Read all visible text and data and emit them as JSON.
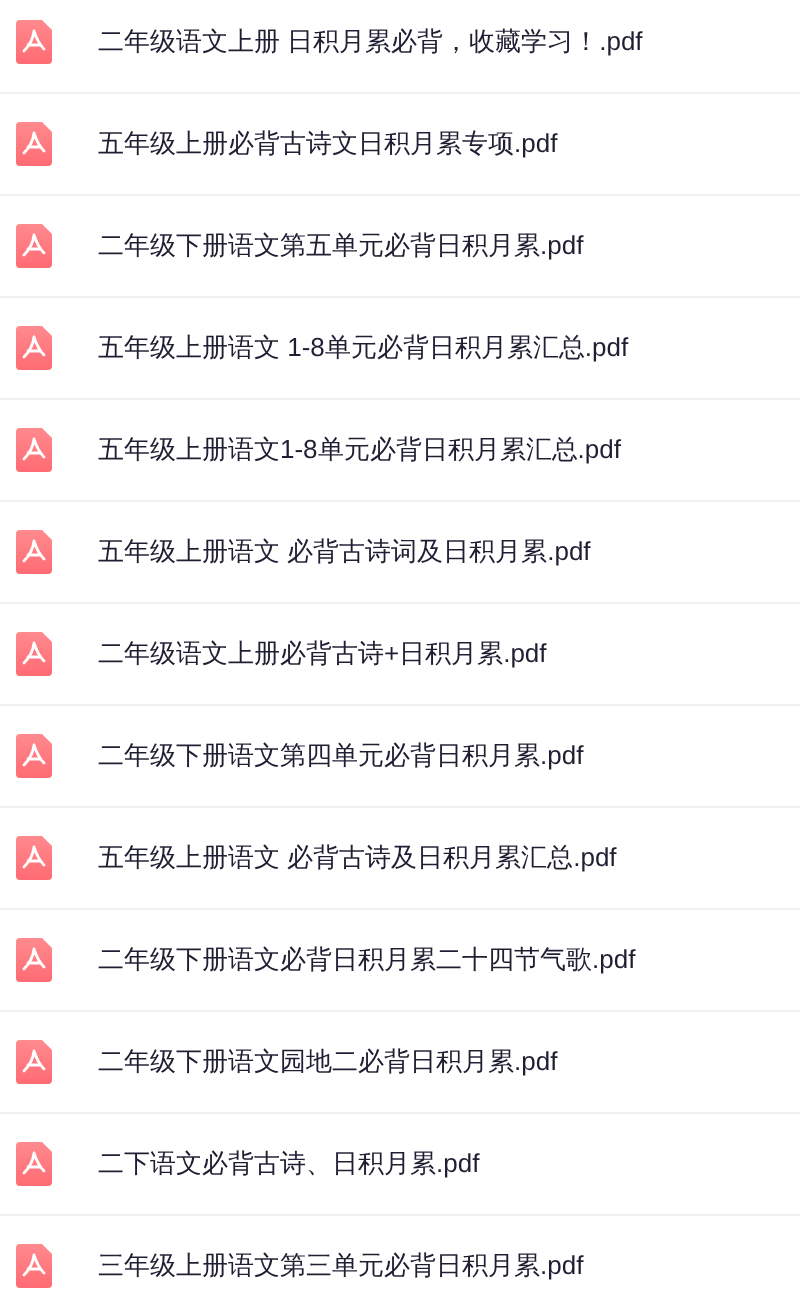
{
  "files": [
    {
      "name": "二年级语文上册 日积月累必背，收藏学习！.pdf"
    },
    {
      "name": "五年级上册必背古诗文日积月累专项.pdf"
    },
    {
      "name": "二年级下册语文第五单元必背日积月累.pdf"
    },
    {
      "name": "五年级上册语文 1-8单元必背日积月累汇总.pdf"
    },
    {
      "name": "五年级上册语文1-8单元必背日积月累汇总.pdf"
    },
    {
      "name": "五年级上册语文 必背古诗词及日积月累.pdf"
    },
    {
      "name": "二年级语文上册必背古诗+日积月累.pdf"
    },
    {
      "name": "二年级下册语文第四单元必背日积月累.pdf"
    },
    {
      "name": "五年级上册语文 必背古诗及日积月累汇总.pdf"
    },
    {
      "name": "二年级下册语文必背日积月累二十四节气歌.pdf"
    },
    {
      "name": "二年级下册语文园地二必背日积月累.pdf"
    },
    {
      "name": "二下语文必背古诗、日积月累.pdf"
    },
    {
      "name": "三年级上册语文第三单元必背日积月累.pdf"
    }
  ]
}
